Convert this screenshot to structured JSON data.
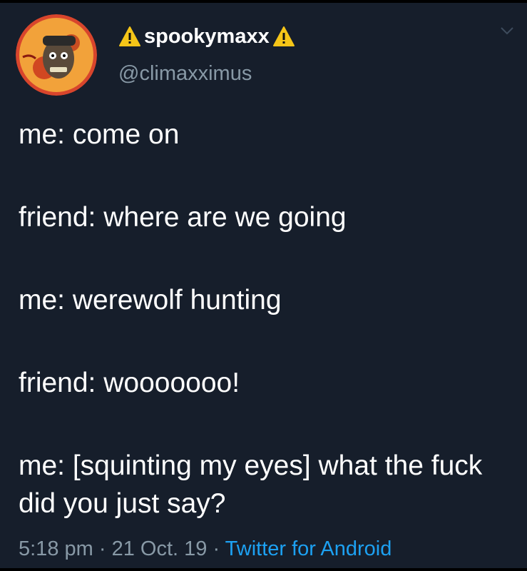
{
  "user": {
    "display_name": "spookymaxx",
    "name_icon": "warning-icon",
    "handle": "@climaxximus"
  },
  "tweet": {
    "lines": [
      "me: come on",
      "friend: where are we going",
      "me: werewolf hunting",
      "friend: wooooooo!",
      "me: [squinting my eyes] what the fuck did you just say?"
    ]
  },
  "meta": {
    "time": "5:18 pm",
    "separator": " · ",
    "date": "21 Oct. 19",
    "source": "Twitter for Android"
  },
  "colors": {
    "background": "#161e2b",
    "primary_text": "#ffffff",
    "secondary_text": "#8899a6",
    "link": "#1da1f2",
    "warning_yellow": "#f5c518"
  }
}
